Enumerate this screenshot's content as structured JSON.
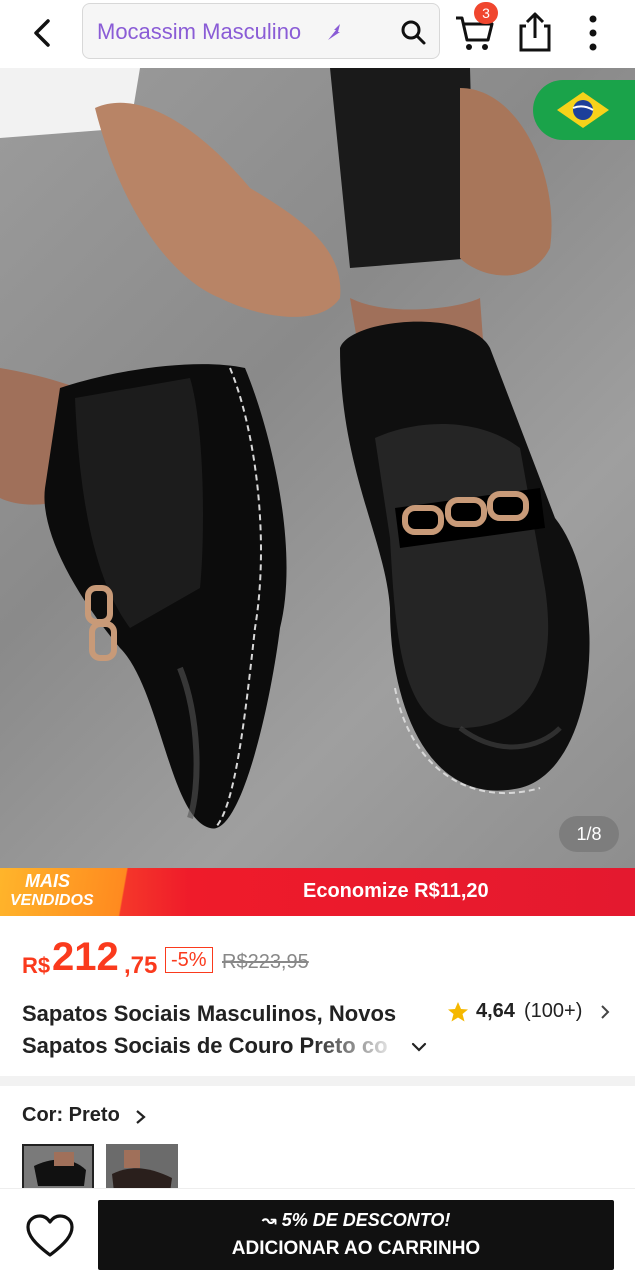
{
  "header": {
    "search_text": "Mocassim Masculino",
    "cart_count": "3"
  },
  "gallery": {
    "counter": "1/8"
  },
  "promo": {
    "badge_line1": "MAIS",
    "badge_line2": "VENDIDOS",
    "savings": "Economize R$11,20"
  },
  "price": {
    "currency": "R$",
    "integer": "212",
    "decimal": ",75",
    "discount": "-5%",
    "original": "R$223,95"
  },
  "product": {
    "title": "Sapatos Sociais Masculinos, Novos Sapatos Sociais de Couro Preto co",
    "rating": "4,64",
    "rating_count": "(100+)"
  },
  "variant": {
    "color_label": "Cor: Preto"
  },
  "bottom_bar": {
    "cta_promo": "↝ 5% DE DESCONTO!",
    "cta_label": "ADICIONAR AO CARRINHO"
  },
  "colors": {
    "accent_red": "#fa3a1d",
    "search_text": "#8a5cd6",
    "cta_bg": "#111111"
  }
}
